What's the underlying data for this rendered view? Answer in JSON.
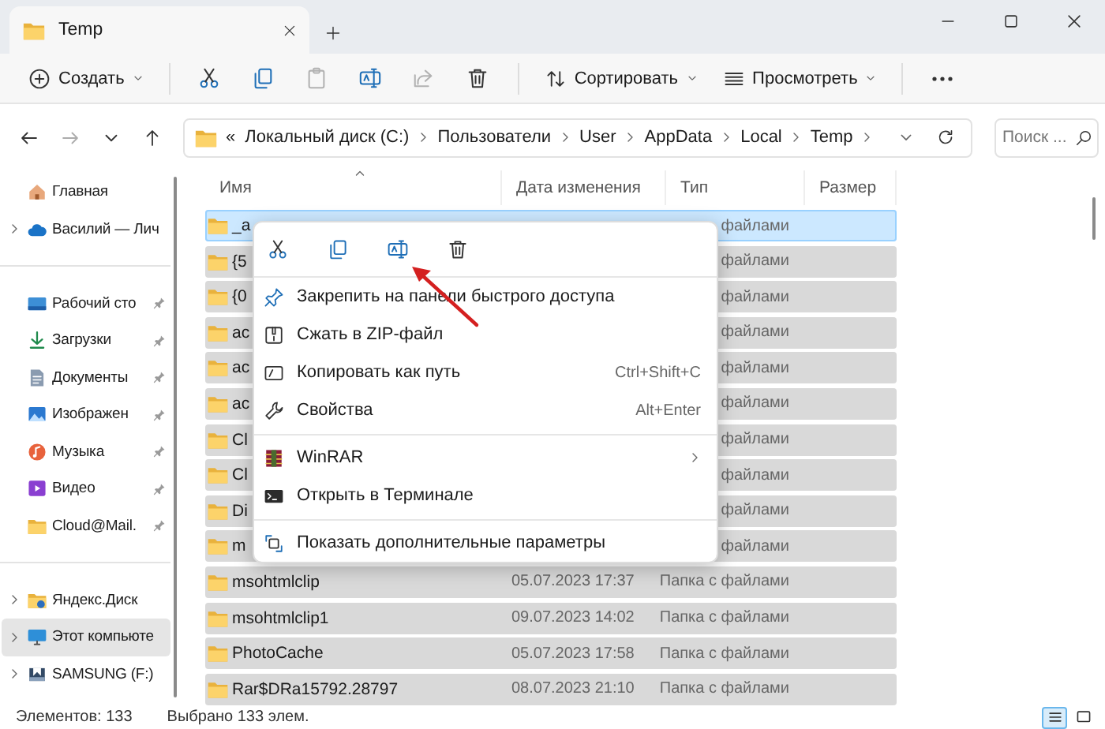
{
  "window": {
    "tab": {
      "title": "Temp"
    }
  },
  "toolbar": {
    "create": {
      "label": "Создать"
    },
    "actions": [
      {
        "disabled": false
      },
      {
        "disabled": false
      },
      {
        "disabled": true
      },
      {
        "disabled": false
      },
      {
        "disabled": true
      },
      {
        "disabled": false
      }
    ],
    "sort": {
      "label": "Сортировать"
    },
    "view": {
      "label": "Просмотреть"
    }
  },
  "navigation": [
    {
      "disabled": false
    },
    {
      "disabled": true
    },
    {
      "disabled": false
    },
    {
      "disabled": false
    }
  ],
  "address_bar": {
    "overflow": "«",
    "crumbs": [
      "Локальный диск (C:)",
      "Пользователи",
      "User",
      "AppData",
      "Local",
      "Temp"
    ]
  },
  "search": {
    "placeholder": "Поиск ..."
  },
  "sidebar": {
    "items": [
      {
        "kind": "item",
        "label": "Главная",
        "expandable": false,
        "pinned": false,
        "selected": false
      },
      {
        "kind": "item",
        "label": "Василий — Лич",
        "expandable": true,
        "pinned": false,
        "selected": false
      },
      {
        "kind": "separator"
      },
      {
        "kind": "item",
        "label": "Рабочий сто",
        "expandable": false,
        "pinned": true,
        "selected": false
      },
      {
        "kind": "item",
        "label": "Загрузки",
        "expandable": false,
        "pinned": true,
        "selected": false
      },
      {
        "kind": "item",
        "label": "Документы",
        "expandable": false,
        "pinned": true,
        "selected": false
      },
      {
        "kind": "item",
        "label": "Изображен",
        "expandable": false,
        "pinned": true,
        "selected": false
      },
      {
        "kind": "item",
        "label": "Музыка",
        "expandable": false,
        "pinned": true,
        "selected": false
      },
      {
        "kind": "item",
        "label": "Видео",
        "expandable": false,
        "pinned": true,
        "selected": false
      },
      {
        "kind": "item",
        "label": "Cloud@Mail.",
        "expandable": false,
        "pinned": true,
        "selected": false
      },
      {
        "kind": "separator"
      },
      {
        "kind": "item",
        "label": "Яндекс.Диск",
        "expandable": true,
        "pinned": false,
        "selected": false
      },
      {
        "kind": "item",
        "label": "Этот компьюте",
        "expandable": true,
        "pinned": false,
        "selected": true
      },
      {
        "kind": "item",
        "label": "SAMSUNG (F:)",
        "expandable": true,
        "pinned": false,
        "selected": false
      }
    ]
  },
  "file_list": {
    "columns": [
      "Имя",
      "Дата изменения",
      "Тип",
      "Размер"
    ],
    "rows": [
      {
        "name": "_a",
        "type": "файлами",
        "selected": true,
        "focused": true
      },
      {
        "name": "{5",
        "type": "файлами",
        "selected": true,
        "focused": false
      },
      {
        "name": "{0",
        "type": "файлами",
        "selected": true,
        "focused": false
      },
      {
        "name": "ac",
        "type": "файлами",
        "selected": true,
        "focused": false
      },
      {
        "name": "ac",
        "type": "файлами",
        "selected": true,
        "focused": false
      },
      {
        "name": "ac",
        "type": "файлами",
        "selected": true,
        "focused": false
      },
      {
        "name": "Cl",
        "type": "файлами",
        "selected": true,
        "focused": false
      },
      {
        "name": "Cl",
        "type": "файлами",
        "selected": true,
        "focused": false
      },
      {
        "name": "Di",
        "type": "файлами",
        "selected": true,
        "focused": false
      },
      {
        "name": "m",
        "type": "файлами",
        "selected": true,
        "focused": false
      },
      {
        "name": "msohtmlclip",
        "date": "05.07.2023 17:37",
        "type": "Папка с файлами",
        "selected": true,
        "focused": false
      },
      {
        "name": "msohtmlclip1",
        "date": "09.07.2023 14:02",
        "type": "Папка с файлами",
        "selected": true,
        "focused": false
      },
      {
        "name": "PhotoCache",
        "date": "05.07.2023 17:58",
        "type": "Папка с файлами",
        "selected": true,
        "focused": false
      },
      {
        "name": "Rar$DRa15792.28797",
        "date": "08.07.2023 21:10",
        "type": "Папка с файлами",
        "selected": true,
        "focused": false
      }
    ]
  },
  "context_menu": {
    "items": [
      {
        "kind": "item",
        "label": "Закрепить на панели быстрого доступа"
      },
      {
        "kind": "item",
        "label": "Сжать в ZIP-файл"
      },
      {
        "kind": "item",
        "label": "Копировать как путь",
        "shortcut": "Ctrl+Shift+C"
      },
      {
        "kind": "item",
        "label": "Свойства",
        "shortcut": "Alt+Enter"
      },
      {
        "kind": "separator"
      },
      {
        "kind": "submenu",
        "label": "WinRAR"
      },
      {
        "kind": "item",
        "label": "Открыть в Терминале"
      },
      {
        "kind": "separator"
      },
      {
        "kind": "item",
        "label": "Показать дополнительные параметры"
      }
    ]
  },
  "status_bar": {
    "items_count": "Элементов: 133",
    "selection": "Выбрано 133 элем.",
    "views": [
      {
        "selected": true
      },
      {
        "selected": false
      }
    ]
  }
}
